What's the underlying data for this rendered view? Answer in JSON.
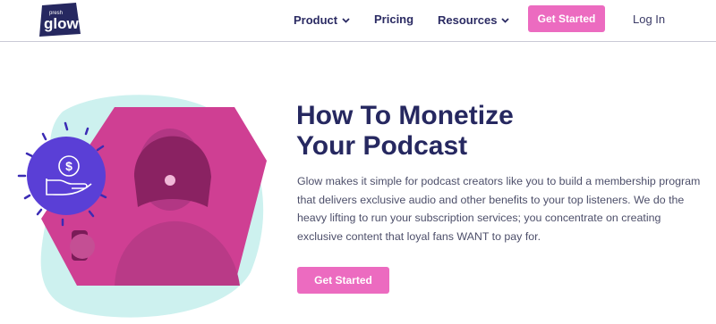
{
  "brand": {
    "logo_small": "presh",
    "logo_text": "glow"
  },
  "nav": {
    "product": "Product",
    "pricing": "Pricing",
    "resources": "Resources",
    "cta": "Get Started",
    "login": "Log In"
  },
  "hero": {
    "title_line1": "How To Monetize",
    "title_line2": "Your Podcast",
    "description": "Glow makes it simple for podcast creators like you to build a membership program that delivers exclusive audio and other benefits to your top listeners. We do the heavy lifting to run your subscription services; you concentrate on creating exclusive content that loyal fans WANT to pay for.",
    "cta": "Get Started",
    "badge_symbol": "$"
  },
  "colors": {
    "brand_navy": "#262860",
    "accent_pink": "#ec6bc0",
    "badge_purple": "#5a3fd6",
    "mint_blob": "#cdf1ef",
    "photo_magenta": "#cf3f93"
  },
  "icons": {
    "product_chevron": "chevron-down-icon",
    "resources_chevron": "chevron-down-icon",
    "badge": "dollar-hand-icon"
  }
}
